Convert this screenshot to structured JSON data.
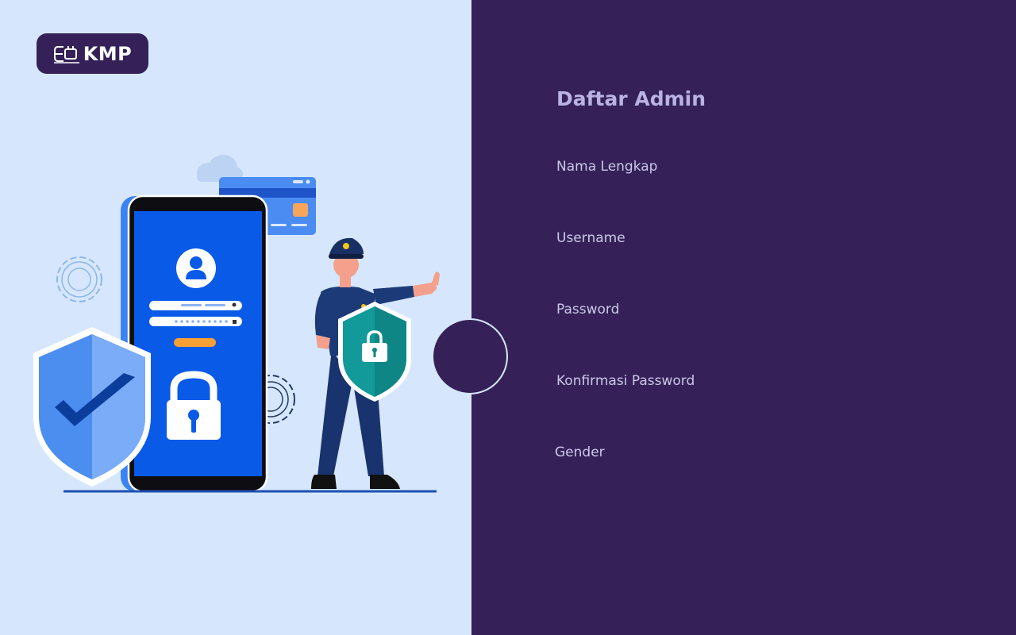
{
  "logo": {
    "text": "KMP"
  },
  "illustration": {
    "icons": [
      "cloud-icon",
      "credit-card-icon",
      "gear-icon",
      "smartphone-icon",
      "user-avatar-icon",
      "padlock-icon",
      "shield-check-icon",
      "security-guard-figure",
      "shield-lock-icon"
    ]
  },
  "form": {
    "title": "Daftar Admin",
    "fields": [
      {
        "label": "Nama Lengkap"
      },
      {
        "label": "Username"
      },
      {
        "label": "Password"
      },
      {
        "label": "Konfirmasi Password"
      },
      {
        "label": "Gender"
      }
    ]
  },
  "colors": {
    "left_background": "#d6e7fd",
    "right_background": "#352157",
    "title": "#b9b2e3",
    "label": "#cbc6ea"
  }
}
